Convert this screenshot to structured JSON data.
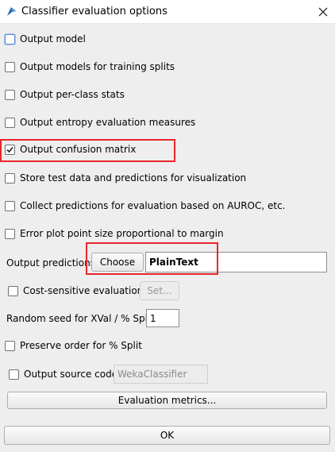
{
  "window": {
    "title": "Classifier evaluation options"
  },
  "options": {
    "output_model": "Output model",
    "output_models_training_splits": "Output models for training splits",
    "output_per_class_stats": "Output per-class stats",
    "output_entropy": "Output entropy evaluation measures",
    "output_confusion_matrix": "Output confusion matrix",
    "store_test_data": "Store test data and predictions for visualization",
    "collect_predictions": "Collect predictions for evaluation based on AUROC, etc.",
    "error_plot": "Error plot point size proportional to margin",
    "checked": {
      "output_model": false,
      "output_models_training_splits": false,
      "output_per_class_stats": false,
      "output_entropy": false,
      "output_confusion_matrix": true,
      "store_test_data": false,
      "collect_predictions": false,
      "error_plot": false,
      "cost_sensitive": false,
      "preserve_order": false,
      "output_source_code": false
    }
  },
  "output_predictions": {
    "label": "Output predictions",
    "choose_label": "Choose",
    "value": "PlainText"
  },
  "cost_sensitive": {
    "label": "Cost-sensitive evaluation",
    "set_label": "Set..."
  },
  "random_seed": {
    "label": "Random seed for XVal / % Split",
    "value": "1"
  },
  "preserve_order": {
    "label": "Preserve order for % Split"
  },
  "source_code": {
    "label": "Output source code",
    "value": "WekaClassifier"
  },
  "buttons": {
    "evaluation_metrics": "Evaluation metrics...",
    "ok": "OK"
  },
  "colors": {
    "highlight": "#e8262c",
    "check": "#222222"
  }
}
